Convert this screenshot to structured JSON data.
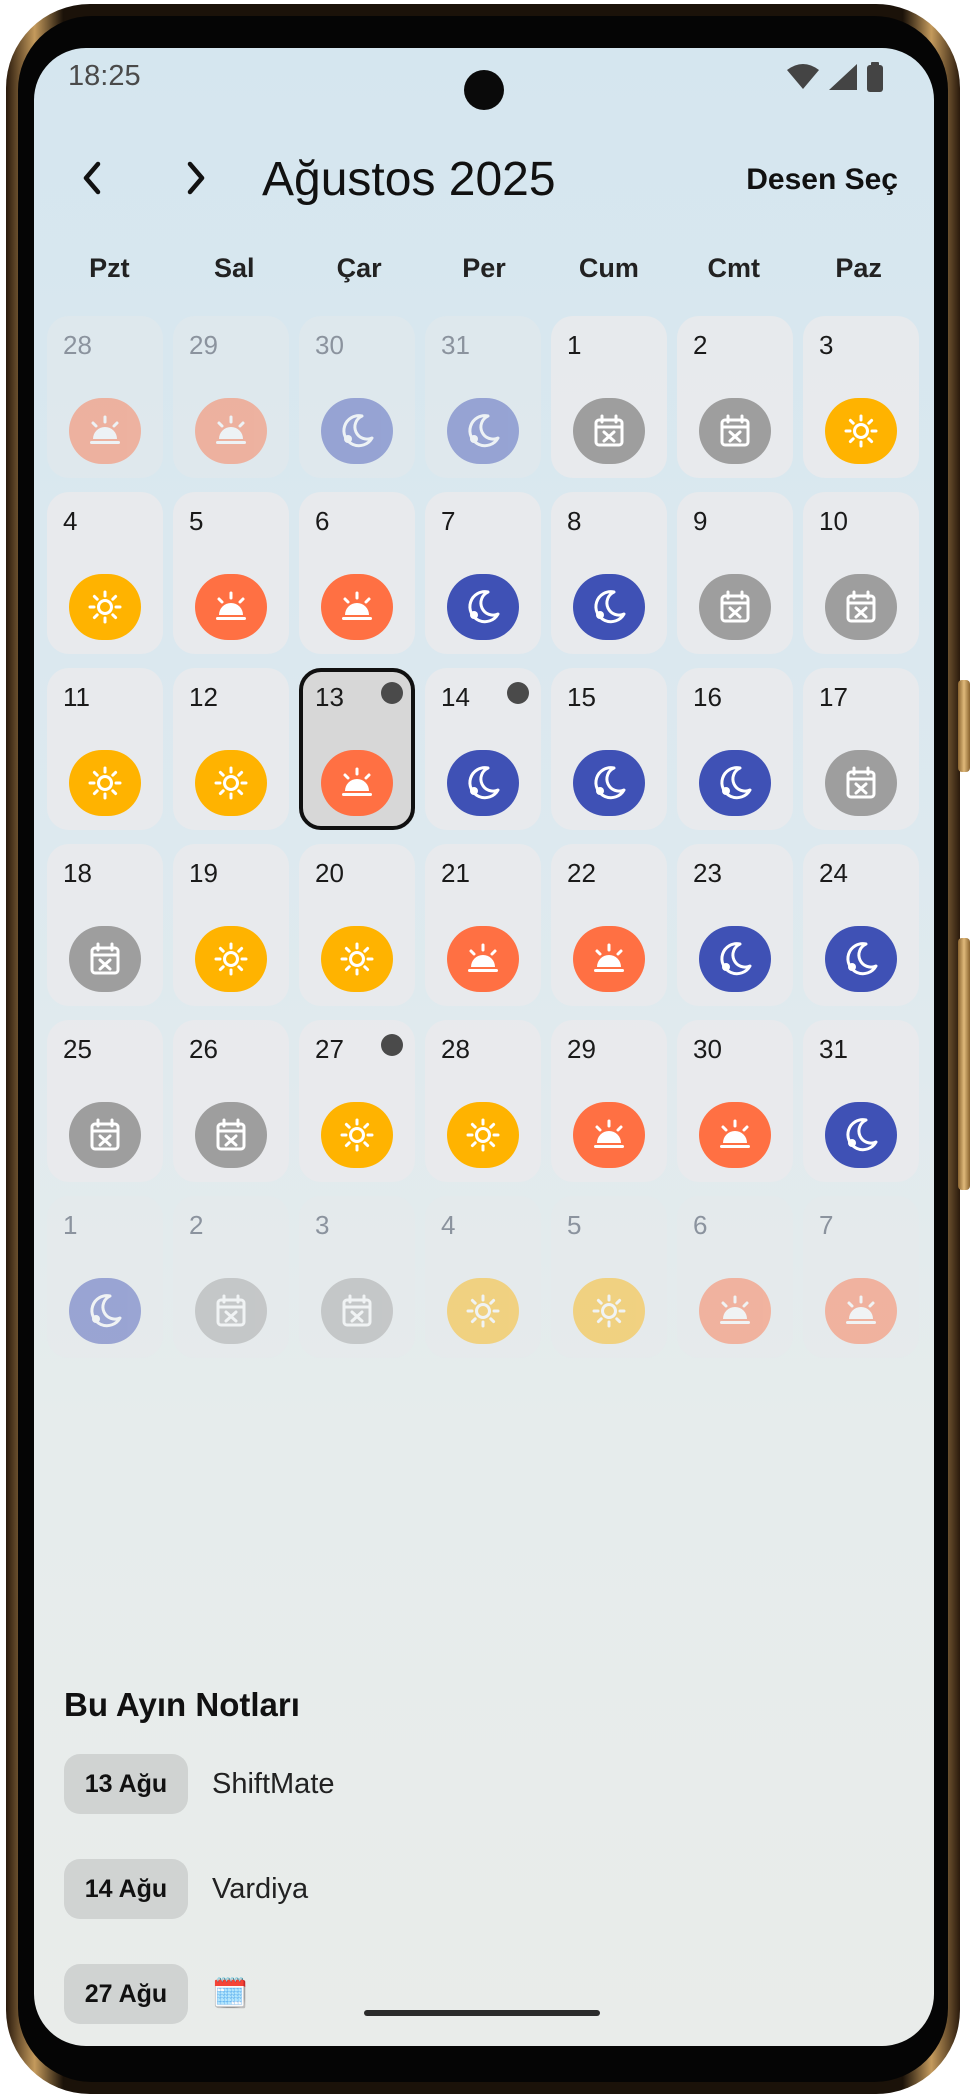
{
  "status_bar": {
    "time": "18:25"
  },
  "header": {
    "prev_icon": "chevron-left-icon",
    "next_icon": "chevron-right-icon",
    "title": "Ağustos 2025",
    "pattern_button": "Desen Seç"
  },
  "weekdays": [
    "Pzt",
    "Sal",
    "Çar",
    "Per",
    "Cum",
    "Cmt",
    "Paz"
  ],
  "shift_colors": {
    "morning": "#FF7043",
    "day": "#FFB300",
    "night": "#3F51B5",
    "off": "#9E9E9E"
  },
  "days": [
    {
      "day": "28",
      "shift": "morning",
      "other": true
    },
    {
      "day": "29",
      "shift": "morning",
      "other": true
    },
    {
      "day": "30",
      "shift": "night",
      "other": true
    },
    {
      "day": "31",
      "shift": "night",
      "other": true
    },
    {
      "day": "1",
      "shift": "off"
    },
    {
      "day": "2",
      "shift": "off"
    },
    {
      "day": "3",
      "shift": "day"
    },
    {
      "day": "4",
      "shift": "day"
    },
    {
      "day": "5",
      "shift": "morning"
    },
    {
      "day": "6",
      "shift": "morning"
    },
    {
      "day": "7",
      "shift": "night"
    },
    {
      "day": "8",
      "shift": "night"
    },
    {
      "day": "9",
      "shift": "off"
    },
    {
      "day": "10",
      "shift": "off"
    },
    {
      "day": "11",
      "shift": "day"
    },
    {
      "day": "12",
      "shift": "day"
    },
    {
      "day": "13",
      "shift": "morning",
      "selected": true,
      "note": true
    },
    {
      "day": "14",
      "shift": "night",
      "note": true
    },
    {
      "day": "15",
      "shift": "night"
    },
    {
      "day": "16",
      "shift": "night"
    },
    {
      "day": "17",
      "shift": "off"
    },
    {
      "day": "18",
      "shift": "off"
    },
    {
      "day": "19",
      "shift": "day"
    },
    {
      "day": "20",
      "shift": "day"
    },
    {
      "day": "21",
      "shift": "morning"
    },
    {
      "day": "22",
      "shift": "morning"
    },
    {
      "day": "23",
      "shift": "night"
    },
    {
      "day": "24",
      "shift": "night"
    },
    {
      "day": "25",
      "shift": "off"
    },
    {
      "day": "26",
      "shift": "off"
    },
    {
      "day": "27",
      "shift": "day",
      "note": true
    },
    {
      "day": "28",
      "shift": "day"
    },
    {
      "day": "29",
      "shift": "morning"
    },
    {
      "day": "30",
      "shift": "morning"
    },
    {
      "day": "31",
      "shift": "night"
    },
    {
      "day": "1",
      "shift": "night",
      "other": true
    },
    {
      "day": "2",
      "shift": "off",
      "other": true
    },
    {
      "day": "3",
      "shift": "off",
      "other": true
    },
    {
      "day": "4",
      "shift": "day",
      "other": true
    },
    {
      "day": "5",
      "shift": "day",
      "other": true
    },
    {
      "day": "6",
      "shift": "morning",
      "other": true
    },
    {
      "day": "7",
      "shift": "morning",
      "other": true
    }
  ],
  "notes": {
    "title": "Bu Ayın Notları",
    "items": [
      {
        "date": "13 Ağu",
        "text": "ShiftMate"
      },
      {
        "date": "14 Ağu",
        "text": "Vardiya"
      },
      {
        "date": "27 Ağu",
        "text": "🗓️"
      }
    ]
  }
}
